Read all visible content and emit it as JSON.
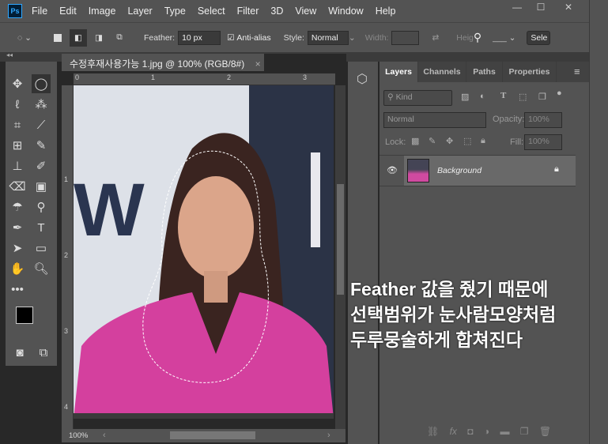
{
  "app": {
    "logo": "Ps"
  },
  "menu": [
    "File",
    "Edit",
    "Image",
    "Layer",
    "Type",
    "Select",
    "Filter",
    "3D",
    "View",
    "Window",
    "Help"
  ],
  "options": {
    "feather_label": "Feather:",
    "feather_value": "10 px",
    "antialias_label": "Anti-alias",
    "style_label": "Style:",
    "style_value": "Normal",
    "width_label": "Width:",
    "height_label": "Heig",
    "select_label": "Sele"
  },
  "document": {
    "tab_title": "수정후재사용가능 1.jpg @ 100% (RGB/8#)",
    "close": "×",
    "zoom": "100%",
    "ruler_top": [
      "0",
      "1",
      "2",
      "3"
    ],
    "ruler_left": [
      "1",
      "2",
      "3",
      "4"
    ]
  },
  "layers_panel": {
    "tabs": [
      "Layers",
      "Channels",
      "Paths",
      "Properties"
    ],
    "kind_label": "Kind",
    "blend_mode": "Normal",
    "opacity_label": "Opacity:",
    "opacity_value": "100%",
    "lock_label": "Lock:",
    "fill_label": "Fill:",
    "fill_value": "100%",
    "layers": [
      {
        "name": "Background",
        "visible": true,
        "locked": true
      }
    ]
  },
  "overlay_text": [
    "Feather 값을 줬기 때문에",
    "선택범위가 눈사람모양처럼",
    "두루뭉술하게 합쳐진다"
  ]
}
